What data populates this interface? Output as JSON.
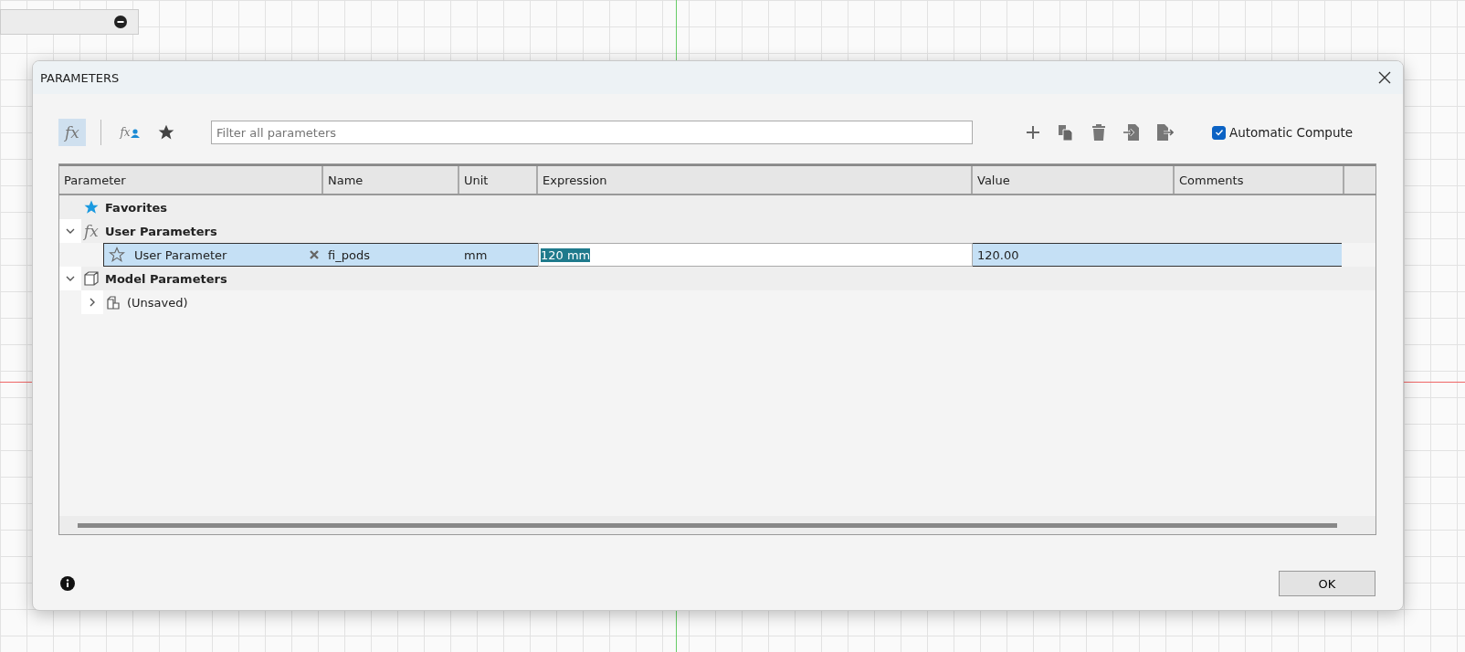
{
  "window": {
    "title": "PARAMETERS"
  },
  "toolbar": {
    "views": [
      {
        "kind": "all",
        "icon": "fx",
        "selected": true
      },
      {
        "kind": "user",
        "icon": "fx",
        "selected": false
      },
      {
        "kind": "favorites",
        "selected": false
      }
    ],
    "filter": {
      "placeholder": "Filter all parameters"
    },
    "automatic_compute": {
      "label": "Automatic Compute",
      "checked": true
    }
  },
  "table": {
    "columns": [
      "Parameter",
      "Name",
      "Unit",
      "Expression",
      "Value",
      "Comments"
    ],
    "tree": [
      {
        "kind": "favorites",
        "label": "Favorites"
      },
      {
        "kind": "user",
        "icon": "fx",
        "label": "User Parameters",
        "expanded": true,
        "children": [
          {
            "kind": "param",
            "parameter": "User Parameter",
            "name": "fi_pods",
            "unit": "mm",
            "expression": "120 mm",
            "value": "120.00",
            "selected": true,
            "favorite": false
          }
        ]
      },
      {
        "kind": "model",
        "label": "Model Parameters",
        "expanded": true,
        "children": [
          {
            "kind": "component",
            "label": "(Unsaved)",
            "expanded": false
          }
        ]
      }
    ]
  },
  "buttons": [
    "OK"
  ]
}
